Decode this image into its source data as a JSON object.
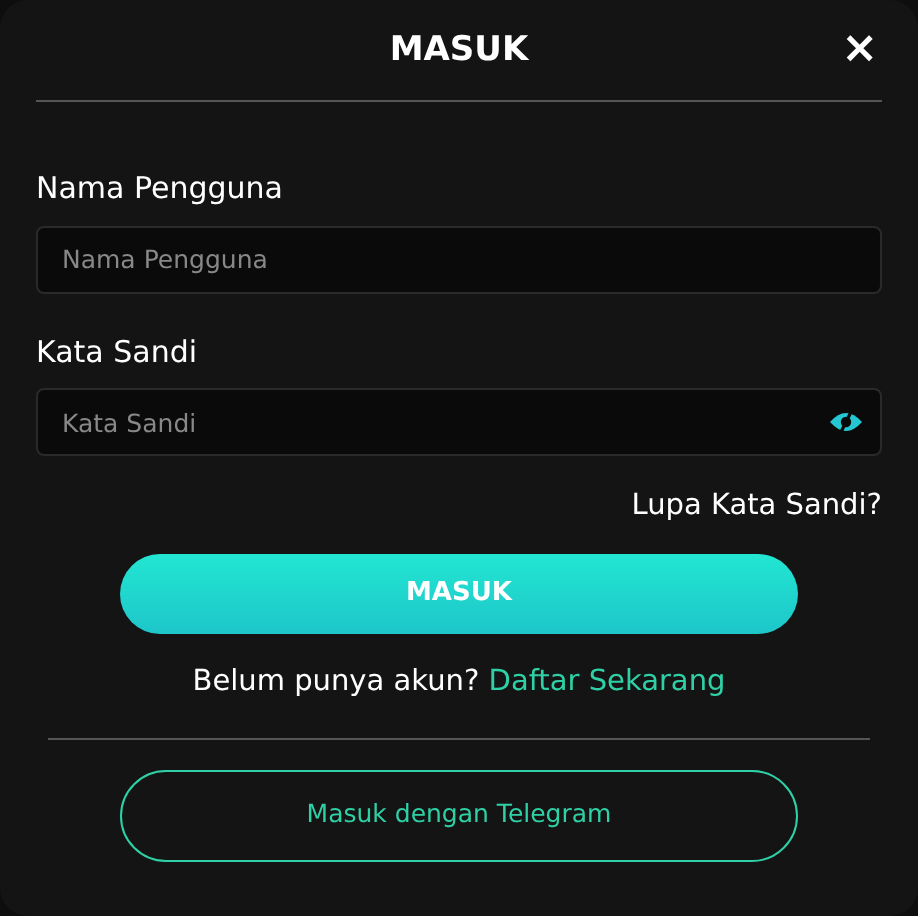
{
  "dialog": {
    "title": "MASUK",
    "close": "×"
  },
  "fields": [
    {
      "label": "Nama Pengguna",
      "placeholder": "Nama Pengguna",
      "kind": "text"
    },
    {
      "label": "Kata Sandi",
      "placeholder": "Kata Sandi",
      "kind": "password"
    }
  ],
  "forgot_link": "Lupa Kata Sandi?",
  "submit_button": "MASUK",
  "register": {
    "prompt": "Belum punya akun?",
    "link": "Daftar Sekarang"
  },
  "telegram_button": "Masuk dengan Telegram"
}
